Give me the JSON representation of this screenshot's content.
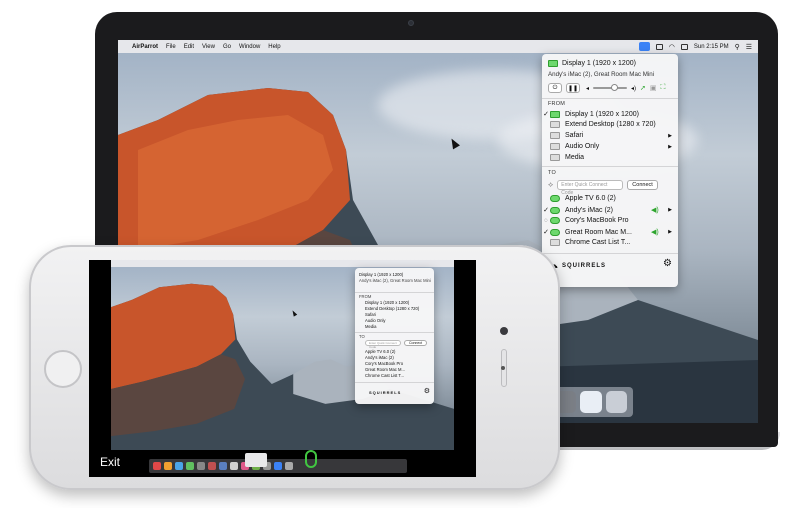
{
  "menubar": {
    "app_name": "AirParrot",
    "items": [
      "File",
      "Edit",
      "View",
      "Go",
      "Window",
      "Help"
    ],
    "clock": "Sun 2:15 PM"
  },
  "airparrot_menu": {
    "current_display": "Display 1 (1920 x 1200)",
    "current_targets": "Andy's iMac (2), Great Room Mac Mini",
    "from_label": "FROM",
    "sources": [
      {
        "label": "Display 1 (1920 x 1200)",
        "checked": true,
        "submenu": false
      },
      {
        "label": "Extend Desktop (1280 x 720)",
        "checked": false,
        "submenu": false
      },
      {
        "label": "Safari",
        "checked": false,
        "submenu": true
      },
      {
        "label": "Audio Only",
        "checked": false,
        "submenu": true
      },
      {
        "label": "Media",
        "checked": false,
        "submenu": false
      }
    ],
    "to_label": "TO",
    "quick_connect_placeholder": "Enter Quick Connect Code",
    "connect_label": "Connect",
    "targets": [
      {
        "label": "Apple TV 6.0 (2)",
        "checked": false,
        "audio": false,
        "submenu": false
      },
      {
        "label": "Andy's iMac (2)",
        "checked": true,
        "audio": true,
        "submenu": true
      },
      {
        "label": "Cory's MacBook Pro",
        "checked": false,
        "audio": false,
        "submenu": false
      },
      {
        "label": "Great Room Mac M...",
        "checked": true,
        "audio": true,
        "submenu": true
      },
      {
        "label": "Chrome Cast List T...",
        "checked": false,
        "audio": false,
        "submenu": false
      }
    ],
    "brand": "SQUIRRELS",
    "small_targets_connect": "Connect"
  },
  "phone": {
    "exit_label": "Exit"
  },
  "colors": {
    "accent_green": "#3cbf3c",
    "menu_bg": "#f6f6f7"
  }
}
